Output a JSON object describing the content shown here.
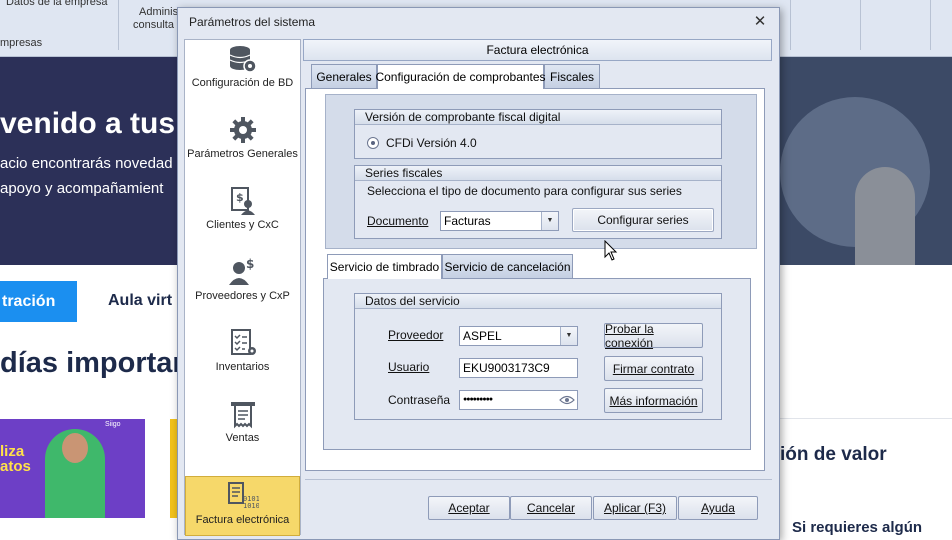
{
  "background": {
    "ribbon": {
      "item1": "Datos de la empresa",
      "group1": "mpresas",
      "item2_line1": "Adminis",
      "item2_line2": "consulta"
    },
    "hero": {
      "title": "venido a tus",
      "line1": "acio encontrarás novedad",
      "line2": "apoyo y acompañamient"
    },
    "tabs": {
      "active": "tración",
      "other": "Aula virt"
    },
    "section_title": "días importar",
    "promo": {
      "line1": "liza",
      "line2": "atos",
      "brand": "Siigo"
    },
    "right_title": "ión de valor",
    "right_sub": "Si requieres algún"
  },
  "dialog": {
    "title": "Parámetros del sistema",
    "close_glyph": "✕",
    "nav": [
      {
        "label": "Configuración de BD",
        "icon": "database-gear-icon"
      },
      {
        "label": "Parámetros Generales",
        "icon": "gear-icon"
      },
      {
        "label": "Clientes y CxC",
        "icon": "clients-money-icon"
      },
      {
        "label": "Proveedores y CxP",
        "icon": "suppliers-money-icon"
      },
      {
        "label": "Inventarios",
        "icon": "inventory-checklist-icon"
      },
      {
        "label": "Ventas",
        "icon": "receipt-icon"
      },
      {
        "label": "Factura electrónica",
        "icon": "invoice-binary-icon",
        "selected": true
      }
    ],
    "panel_header": "Factura electrónica",
    "tabs": [
      "Generales",
      "Configuración de comprobantes",
      "Fiscales"
    ],
    "active_tab": "Configuración de comprobantes",
    "version_group": {
      "title": "Versión de comprobante fiscal digital",
      "radio_label": "CFDi Versión 4.0"
    },
    "series_group": {
      "title": "Series fiscales",
      "instruction": "Selecciona el tipo de documento para configurar sus series",
      "document_label": "Documento",
      "document_value": "Facturas",
      "configure_button": "Configurar series"
    },
    "service_tabs": [
      "Servicio de timbrado",
      "Servicio de cancelación"
    ],
    "active_service_tab": "Servicio de timbrado",
    "service_group": {
      "title": "Datos del servicio",
      "provider_label": "Proveedor",
      "provider_value": "ASPEL",
      "user_label": "Usuario",
      "user_value": "EKU9003173C9",
      "password_label": "Contraseña",
      "password_value": "●●●●●●●●●",
      "test_button": "Probar la conexión",
      "sign_button": "Firmar contrato",
      "info_button": "Más información"
    },
    "footer_buttons": {
      "accept": "Aceptar",
      "cancel": "Cancelar",
      "apply": "Aplicar (F3)",
      "help": "Ayuda"
    },
    "colors": {
      "selected_nav": "#f6d86a",
      "dialog_bg": "#e3e8f2",
      "border": "#8e9bb8"
    }
  }
}
